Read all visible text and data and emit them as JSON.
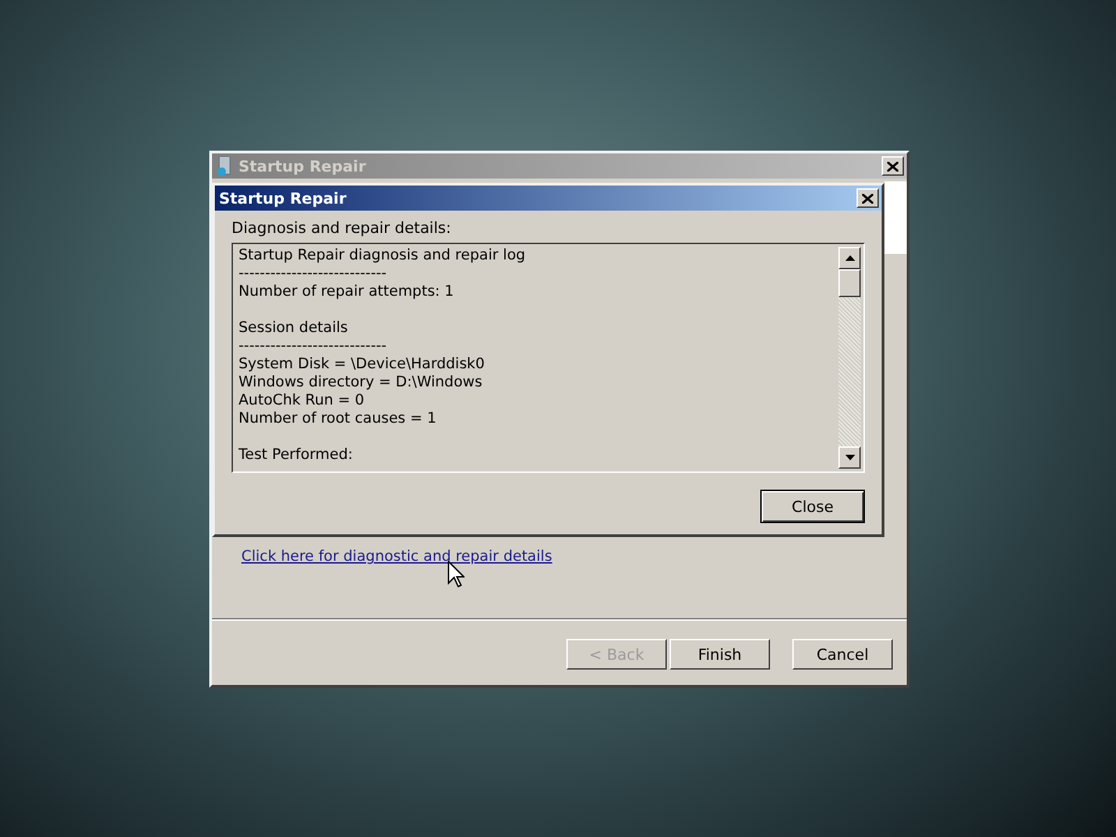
{
  "main_window": {
    "title": "Startup Repair",
    "active": false,
    "link": "Click here for diagnostic and repair details",
    "buttons": [
      {
        "label": "< Back",
        "disabled": true
      },
      {
        "label": "Finish",
        "disabled": false
      },
      {
        "label": "Cancel",
        "disabled": false
      }
    ]
  },
  "details_dialog": {
    "title": "Startup Repair",
    "active": true,
    "label": "Diagnosis and repair details:",
    "log_sections": [
      {
        "lines": [
          "Startup Repair diagnosis and repair log",
          "----------------------------",
          "Number of repair attempts: 1"
        ]
      },
      {
        "lines": [
          "Session details",
          "----------------------------",
          "System Disk = \\Device\\Harddisk0",
          "Windows directory = D:\\Windows",
          "AutoChk Run = 0",
          "Number of root causes = 1"
        ]
      },
      {
        "lines": [
          "Test Performed:"
        ]
      }
    ],
    "button": "Close"
  }
}
